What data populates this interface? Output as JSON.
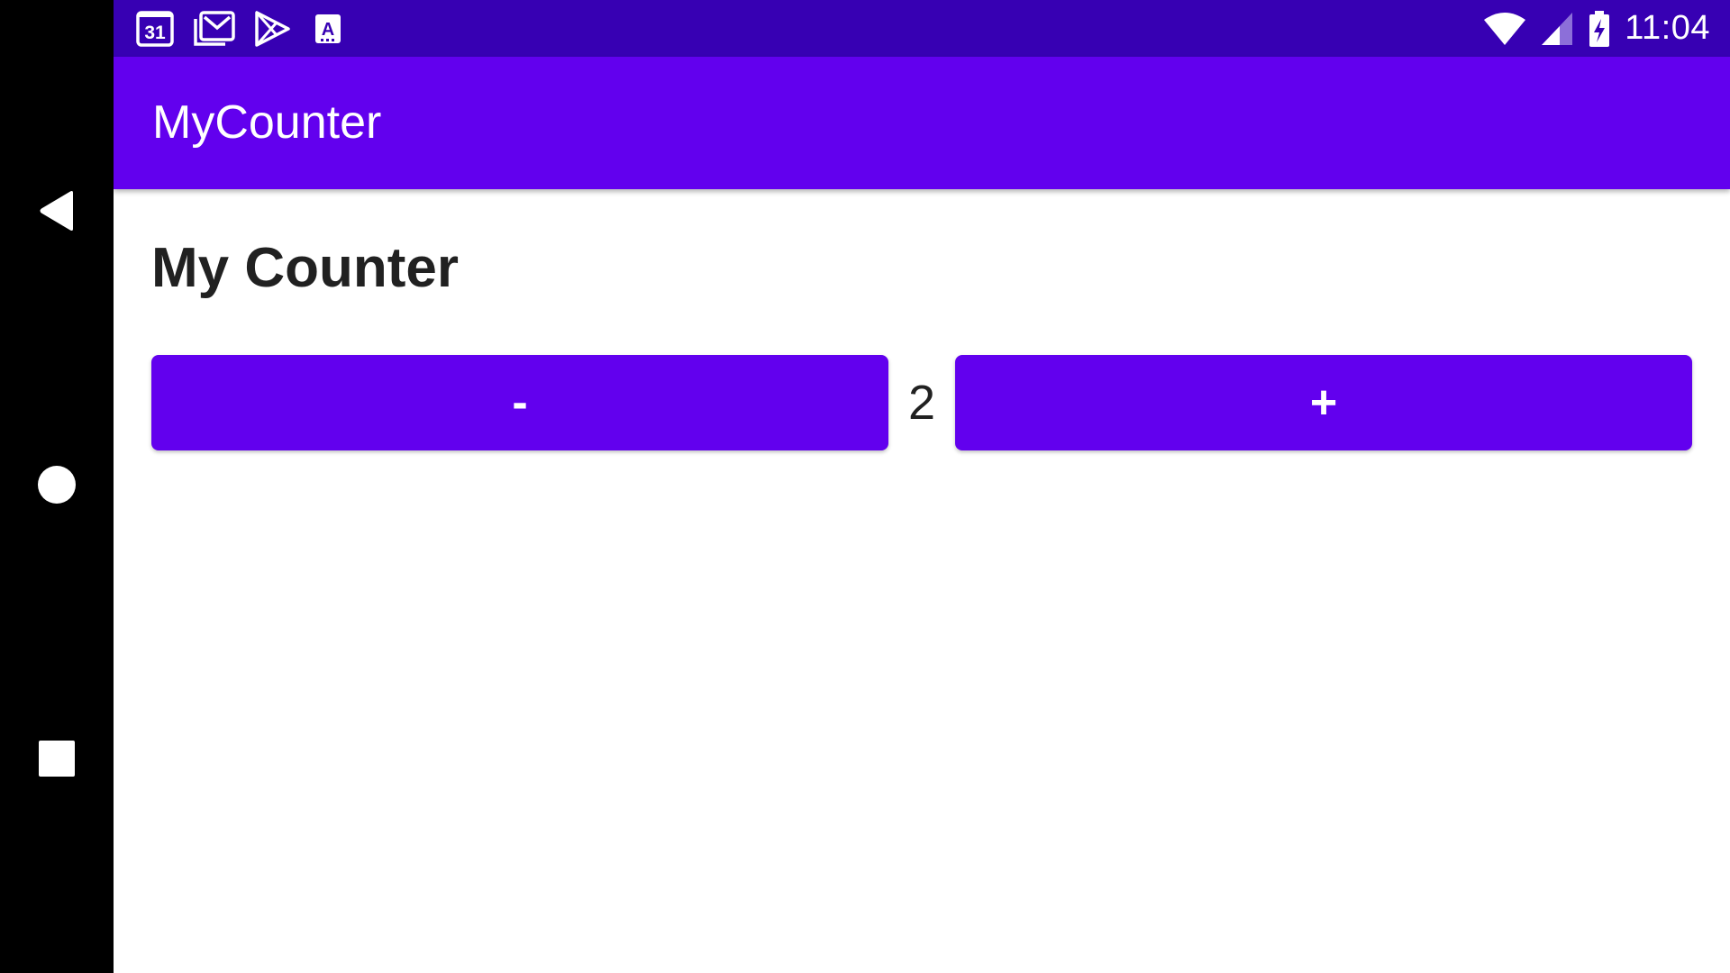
{
  "status_bar": {
    "time": "11:04",
    "calendar_day": "31",
    "left_icons": [
      "calendar-icon",
      "gmail-icon",
      "play-store-icon",
      "text-a-icon"
    ],
    "right_icons": [
      "wifi-icon",
      "cell-signal-icon",
      "battery-charging-icon"
    ]
  },
  "navigation": {
    "buttons": [
      "back-icon",
      "home-icon",
      "recents-icon"
    ]
  },
  "app_bar": {
    "title": "MyCounter"
  },
  "main": {
    "heading": "My Counter",
    "decrement_label": "-",
    "counter_value": "2",
    "increment_label": "+"
  },
  "colors": {
    "status_bar": "#3700b3",
    "primary": "#6200ee",
    "text_dark": "#212121",
    "background": "#ffffff",
    "nav_bar": "#000000"
  }
}
